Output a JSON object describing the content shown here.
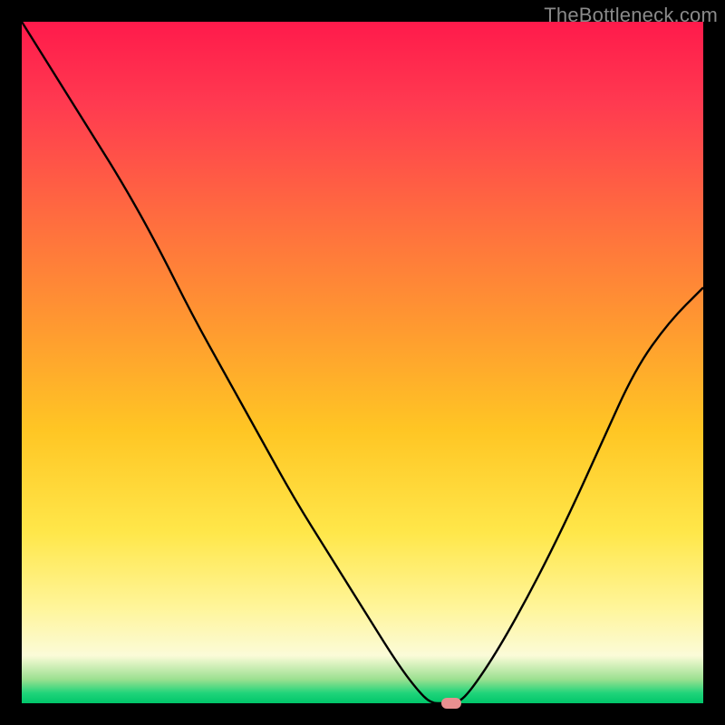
{
  "watermark": "TheBottleneck.com",
  "chart_data": {
    "type": "line",
    "title": "",
    "xlabel": "",
    "ylabel": "",
    "xlim": [
      0,
      100
    ],
    "ylim": [
      0,
      100
    ],
    "grid": false,
    "background_gradient": {
      "stops": [
        {
          "offset": 0.0,
          "color": "#ff1a4b"
        },
        {
          "offset": 0.12,
          "color": "#ff3a50"
        },
        {
          "offset": 0.28,
          "color": "#ff6a40"
        },
        {
          "offset": 0.45,
          "color": "#ff9a30"
        },
        {
          "offset": 0.6,
          "color": "#ffc624"
        },
        {
          "offset": 0.75,
          "color": "#ffe74a"
        },
        {
          "offset": 0.86,
          "color": "#fff59a"
        },
        {
          "offset": 0.93,
          "color": "#fbfbd8"
        },
        {
          "offset": 0.965,
          "color": "#9be090"
        },
        {
          "offset": 0.985,
          "color": "#20d47a"
        },
        {
          "offset": 1.0,
          "color": "#00c66a"
        }
      ]
    },
    "series": [
      {
        "name": "bottleneck-curve",
        "color": "#000000",
        "x": [
          0,
          5,
          10,
          15,
          20,
          25,
          30,
          35,
          40,
          45,
          50,
          55,
          58,
          60,
          62,
          64,
          66,
          70,
          75,
          80,
          85,
          90,
          95,
          100
        ],
        "y": [
          100,
          92,
          84,
          76,
          67,
          57,
          48,
          39,
          30,
          22,
          14,
          6,
          2,
          0,
          0,
          0,
          2,
          8,
          17,
          27,
          38,
          49,
          56,
          61
        ]
      }
    ],
    "marker": {
      "name": "optimal-point",
      "x": 63,
      "y": 0,
      "color": "#e89090"
    }
  }
}
